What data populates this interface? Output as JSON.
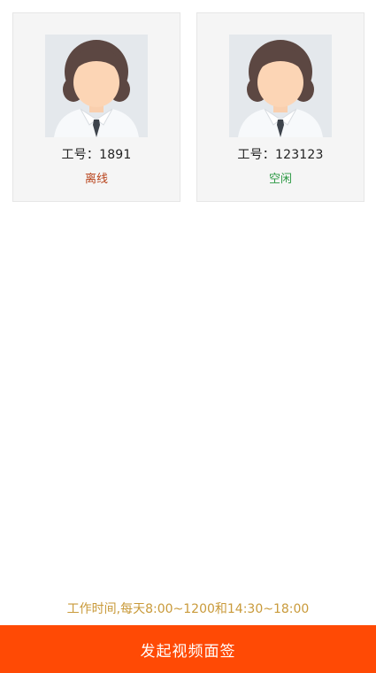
{
  "agents": [
    {
      "id_label": "工号：1891",
      "status": "离线",
      "status_color": "#b8431b"
    },
    {
      "id_label": "工号：123123",
      "status": "空闲",
      "status_color": "#2e9a45"
    }
  ],
  "footer": {
    "hours_note": "工作时间,每天8:00~1200和14:30~18:00",
    "cta_label": "发起视频面签",
    "cta_color": "#ff4a05"
  }
}
